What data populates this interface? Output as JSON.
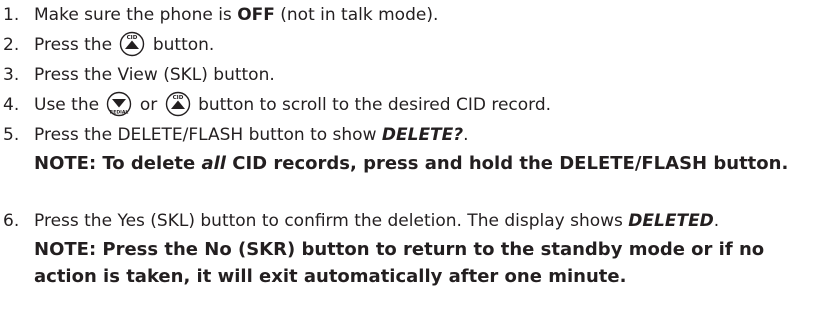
{
  "steps": [
    {
      "num": "1.",
      "pre": "Make sure the phone is ",
      "bold": "OFF",
      "post": " (not in talk mode)."
    },
    {
      "num": "2.",
      "pre": "Press the ",
      "icon": "cid-up-button-icon",
      "icon_label": "CID",
      "post": " button."
    },
    {
      "num": "3.",
      "text": "Press the View (SKL) button."
    },
    {
      "num": "4.",
      "pre": "Use the ",
      "icon_a": "redial-down-button-icon",
      "icon_a_label": "REDIAL",
      "mid": " or ",
      "icon_b": "cid-up-button-icon",
      "icon_b_label": "CID",
      "post": " button to scroll to the desired CID record."
    },
    {
      "num": "5.",
      "pre": "Press the DELETE/FLASH button to show ",
      "bolditalic": "DELETE?",
      "post": ".",
      "note": {
        "pre": "NOTE: To delete ",
        "italic": "all",
        "post": " CID records, press and hold the DELETE/FLASH button."
      }
    },
    {
      "num": "6.",
      "pre": "Press the Yes (SKL) button to confirm the deletion. The display shows ",
      "bolditalic": "DELETED",
      "post": ".",
      "note": {
        "text": "NOTE: Press the No (SKR) button to return to the standby mode or if no action is taken, it will exit automatically after one minute."
      }
    }
  ],
  "colors": {
    "text": "#231f20"
  }
}
